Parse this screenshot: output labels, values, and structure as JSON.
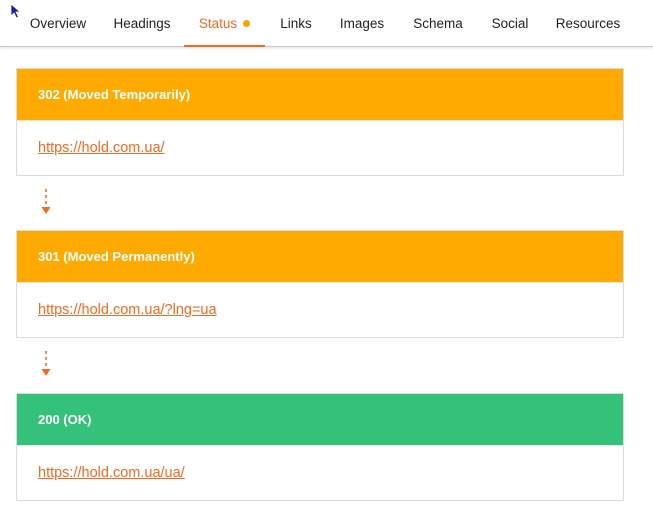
{
  "tabs": [
    {
      "label": "Overview",
      "active": false
    },
    {
      "label": "Headings",
      "active": false
    },
    {
      "label": "Status",
      "active": true
    },
    {
      "label": "Links",
      "active": false
    },
    {
      "label": "Images",
      "active": false
    },
    {
      "label": "Schema",
      "active": false
    },
    {
      "label": "Social",
      "active": false
    },
    {
      "label": "Resources",
      "active": false
    }
  ],
  "redirects": [
    {
      "status": "302 (Moved Temporarily)",
      "url": "https://hold.com.ua/",
      "color": "#ffaa00"
    },
    {
      "status": "301 (Moved Permanently)",
      "url": "https://hold.com.ua/?lng=ua",
      "color": "#ffaa00"
    },
    {
      "status": "200 (OK)",
      "url": "https://hold.com.ua/ua/",
      "color": "#34c17a"
    }
  ],
  "colors": {
    "accent": "#f26a22",
    "redirect": "#ffaa00",
    "ok": "#34c17a",
    "status_dot": "#ffa400"
  },
  "icons": {
    "cursor": "mouse-pointer-icon",
    "arrow": "dashed-down-arrow-icon"
  }
}
